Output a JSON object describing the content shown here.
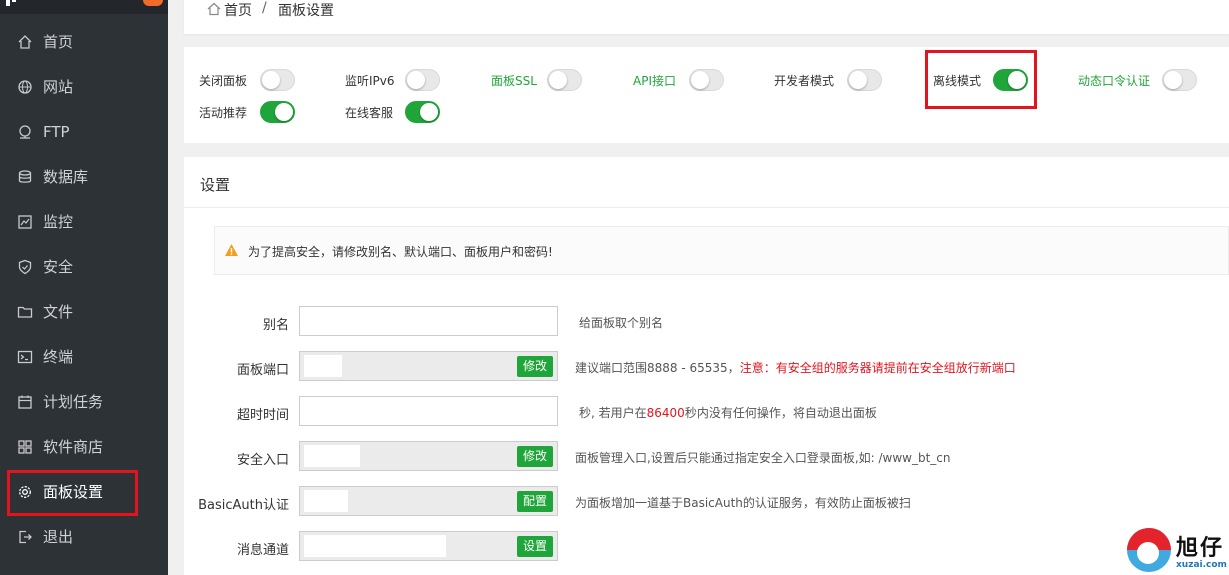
{
  "sidebar": {
    "items": [
      {
        "label": "首页",
        "icon": "home-icon"
      },
      {
        "label": "网站",
        "icon": "globe-icon"
      },
      {
        "label": "FTP",
        "icon": "ftp-icon"
      },
      {
        "label": "数据库",
        "icon": "database-icon"
      },
      {
        "label": "监控",
        "icon": "monitor-icon"
      },
      {
        "label": "安全",
        "icon": "shield-icon"
      },
      {
        "label": "文件",
        "icon": "folder-icon"
      },
      {
        "label": "终端",
        "icon": "terminal-icon"
      },
      {
        "label": "计划任务",
        "icon": "calendar-icon"
      },
      {
        "label": "软件商店",
        "icon": "apps-icon"
      },
      {
        "label": "面板设置",
        "icon": "gear-icon"
      },
      {
        "label": "退出",
        "icon": "logout-icon"
      }
    ]
  },
  "breadcrumb": {
    "home": "首页",
    "separator": "/",
    "current": "面板设置"
  },
  "toggles": [
    {
      "label": "关闭面板",
      "on": false,
      "green": false
    },
    {
      "label": "监听IPv6",
      "on": false,
      "green": false
    },
    {
      "label": "面板SSL",
      "on": false,
      "green": true
    },
    {
      "label": "API接口",
      "on": false,
      "green": true
    },
    {
      "label": "开发者模式",
      "on": false,
      "green": false
    },
    {
      "label": "离线模式",
      "on": true,
      "green": false
    },
    {
      "label": "动态口令认证",
      "on": false,
      "green": true
    },
    {
      "label": "活动推荐",
      "on": true,
      "green": false
    },
    {
      "label": "在线客服",
      "on": true,
      "green": false
    }
  ],
  "settings": {
    "title": "设置",
    "warning": "为了提高安全，请修改别名、默认端口、面板用户和密码!",
    "rows": [
      {
        "label": "别名",
        "button": "",
        "hint": "给面板取个别名",
        "hint_red": "",
        "hint_tail": ""
      },
      {
        "label": "面板端口",
        "button": "修改",
        "hint": "建议端口范围8888 - 65535，",
        "hint_red": "注意：有安全组的服务器请提前在安全组放行新端口",
        "hint_tail": ""
      },
      {
        "label": "超时时间",
        "button": "",
        "hint": "秒, 若用户在",
        "hint_red": "86400",
        "hint_tail": "秒内没有任何操作，将自动退出面板"
      },
      {
        "label": "安全入口",
        "button": "修改",
        "hint": "面板管理入口,设置后只能通过指定安全入口登录面板,如: /www_bt_cn",
        "hint_red": "",
        "hint_tail": ""
      },
      {
        "label": "BasicAuth认证",
        "button": "配置",
        "hint": "为面板增加一道基于BasicAuth的认证服务，有效防止面板被扫",
        "hint_red": "",
        "hint_tail": ""
      },
      {
        "label": "消息通道",
        "button": "设置",
        "hint": "",
        "hint_red": "",
        "hint_tail": ""
      }
    ]
  },
  "watermark": {
    "cn": "旭仔",
    "en": "xuzai.com"
  },
  "colors": {
    "accent": "#20a53a",
    "highlight": "#e4141e",
    "sidebar": "#2d3237"
  }
}
